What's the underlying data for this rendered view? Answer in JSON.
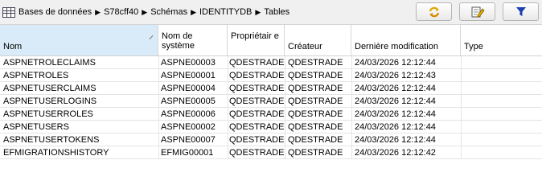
{
  "breadcrumb": {
    "items": [
      "Bases de données",
      "S78cff40",
      "Schémas",
      "IDENTITYDB",
      "Tables"
    ],
    "separator": "▶"
  },
  "toolbar": {
    "refresh_icon": "refresh-icon",
    "edit_icon": "edit-icon",
    "filter_icon": "filter-icon"
  },
  "table": {
    "columns": [
      {
        "label": "Nom",
        "sorted": true
      },
      {
        "label": "Nom de système"
      },
      {
        "label": "Propriétair e"
      },
      {
        "label": "Créateur"
      },
      {
        "label": "Dernière modification"
      },
      {
        "label": "Type"
      }
    ],
    "rows": [
      [
        "ASPNETROLECLAIMS",
        "ASPNE00003",
        "QDESTRADE",
        "QDESTRADE",
        "24/03/2026 12:12:44",
        ""
      ],
      [
        "ASPNETROLES",
        "ASPNE00001",
        "QDESTRADE",
        "QDESTRADE",
        "24/03/2026 12:12:43",
        ""
      ],
      [
        "ASPNETUSERCLAIMS",
        "ASPNE00004",
        "QDESTRADE",
        "QDESTRADE",
        "24/03/2026 12:12:44",
        ""
      ],
      [
        "ASPNETUSERLOGINS",
        "ASPNE00005",
        "QDESTRADE",
        "QDESTRADE",
        "24/03/2026 12:12:44",
        ""
      ],
      [
        "ASPNETUSERROLES",
        "ASPNE00006",
        "QDESTRADE",
        "QDESTRADE",
        "24/03/2026 12:12:44",
        ""
      ],
      [
        "ASPNETUSERS",
        "ASPNE00002",
        "QDESTRADE",
        "QDESTRADE",
        "24/03/2026 12:12:44",
        ""
      ],
      [
        "ASPNETUSERTOKENS",
        "ASPNE00007",
        "QDESTRADE",
        "QDESTRADE",
        "24/03/2026 12:12:44",
        ""
      ],
      [
        "EFMIGRATIONSHISTORY",
        "EFMIG00001",
        "QDESTRADE",
        "QDESTRADE",
        "24/03/2026 12:12:42",
        ""
      ]
    ]
  },
  "colors": {
    "header_sorted": "#d9ebf8",
    "filter_icon": "#1a3fb0",
    "refresh_icon": "#e0a800"
  }
}
